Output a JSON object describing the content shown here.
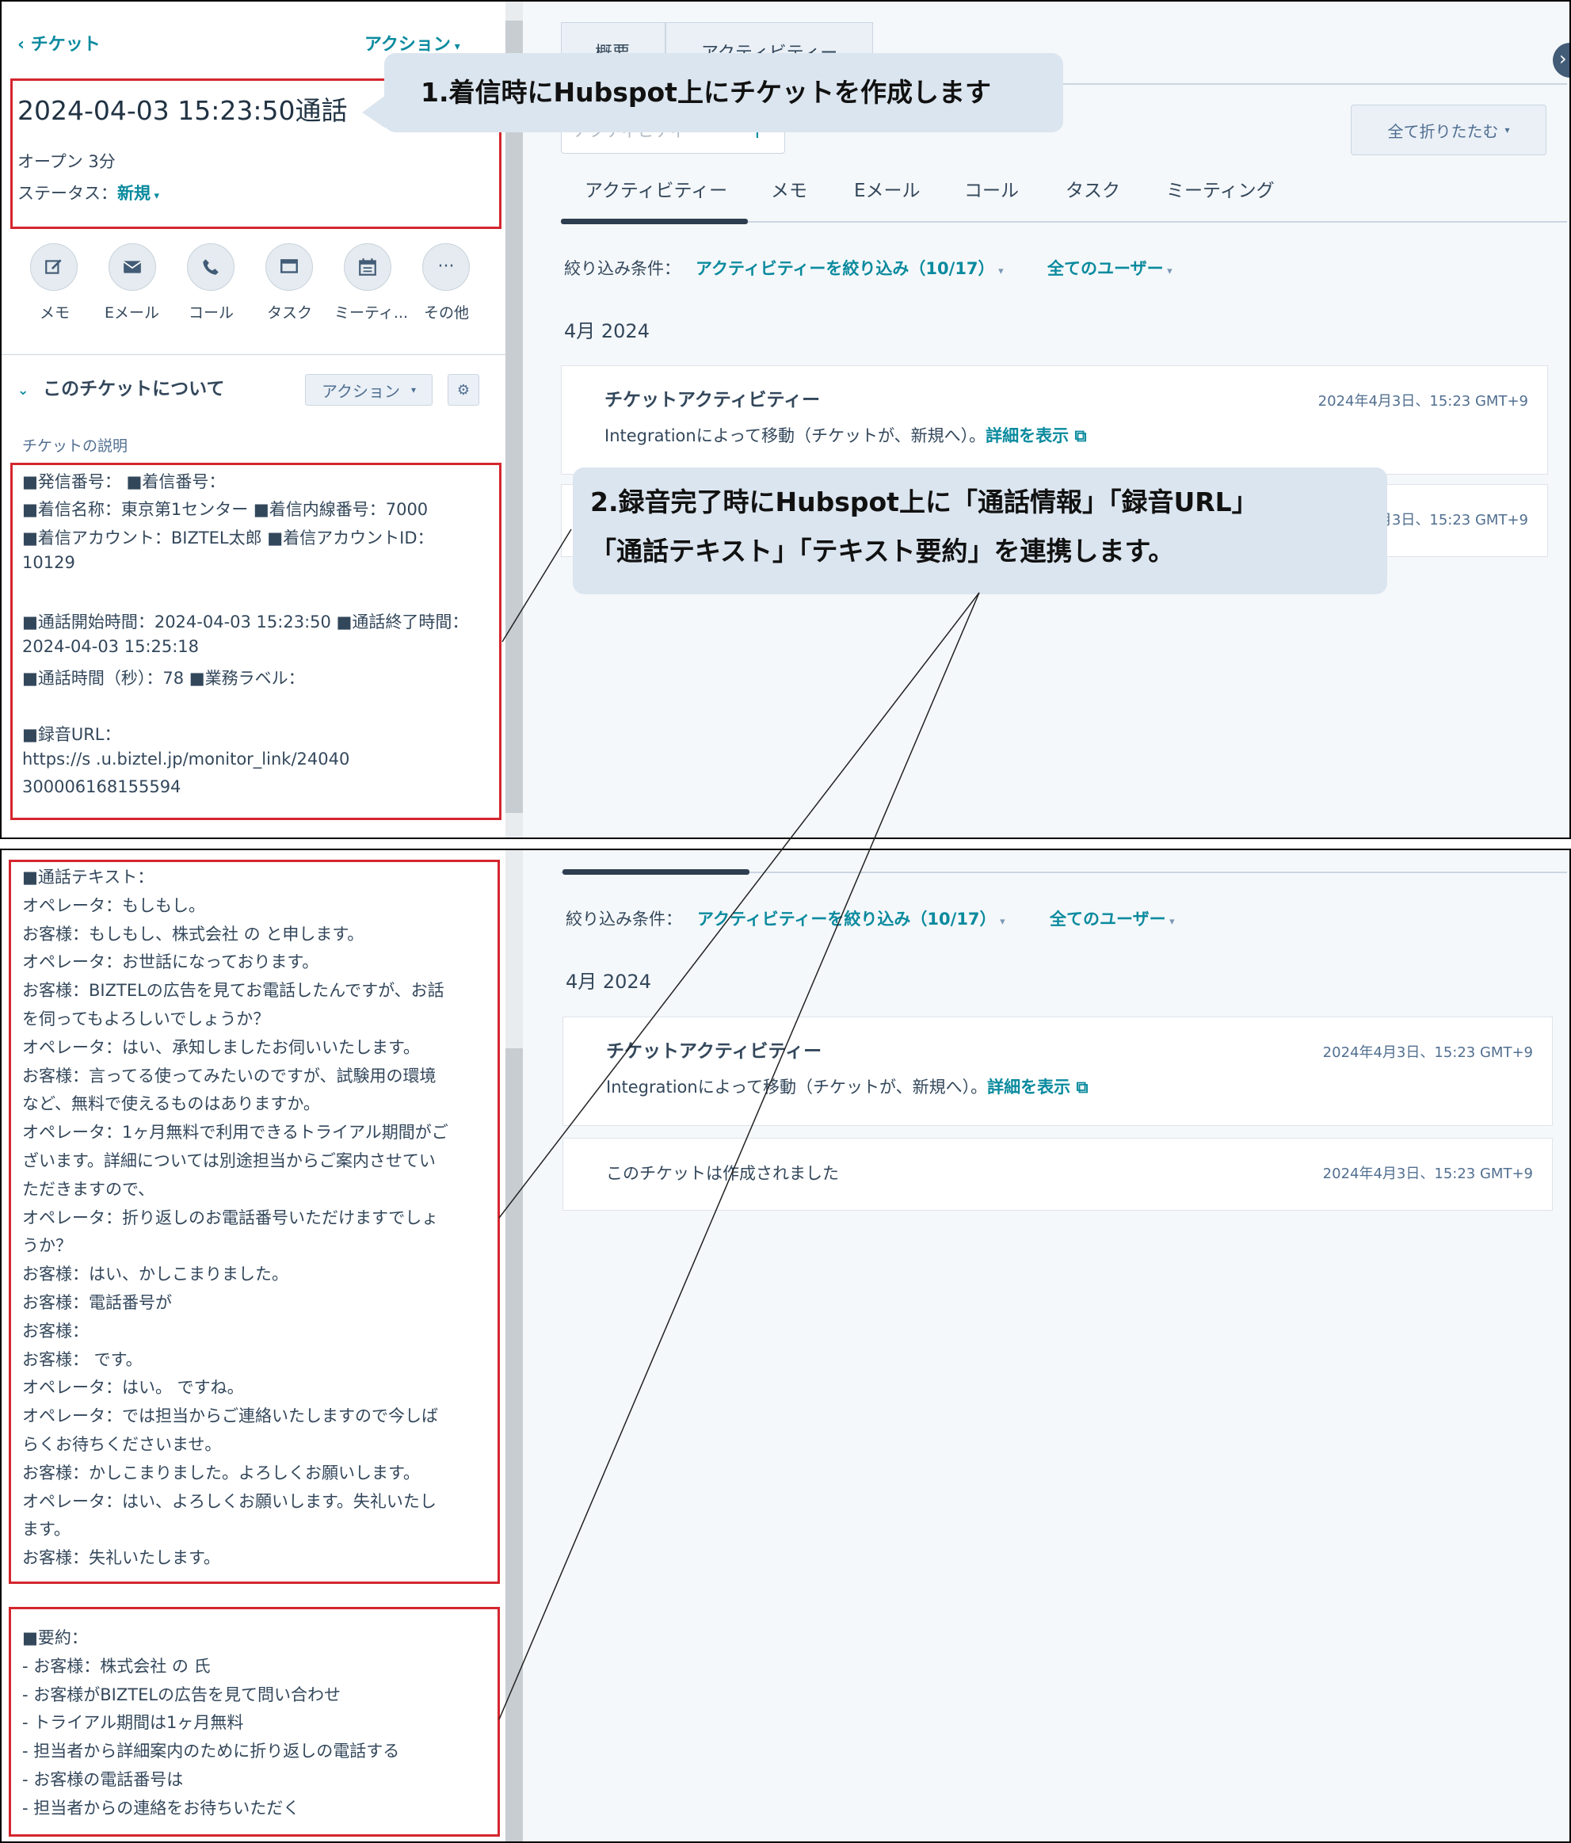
{
  "left": {
    "back_link": "チケット",
    "actions_link": "アクション",
    "ticket_title": "2024-04-03 15:23:50通話",
    "open_time": "オープン 3分",
    "status_label": "ステータス：",
    "status_value": "新規",
    "action_buttons": [
      {
        "label": "メモ",
        "icon": "edit-icon"
      },
      {
        "label": "Eメール",
        "icon": "envelope-icon"
      },
      {
        "label": "コール",
        "icon": "phone-icon"
      },
      {
        "label": "タスク",
        "icon": "monitor-icon"
      },
      {
        "label": "ミーティ...",
        "icon": "calendar-icon"
      },
      {
        "label": "その他",
        "icon": "more-icon"
      }
    ],
    "about_title": "このチケットについて",
    "about_action": "アクション",
    "description_label": "チケットの説明",
    "description_lines": [
      "■発信番号：            ■着信番号：",
      "■着信名称：東京第1センター  ■着信内線番号：7000",
      "■着信アカウント：BIZTEL太郎 ■着信アカウントID：",
      "10129",
      "",
      "■通話開始時間：2024-04-03 15:23:50 ■通話終了時間：",
      "2024-04-03 15:25:18",
      "■通話時間（秒）：78 ■業務ラベル：",
      "",
      "■録音URL：",
      "https://s               .u.biztel.jp/monitor_link/24040",
      "300006168155594"
    ],
    "transcript_lines": [
      "■通話テキスト：",
      "オペレータ：もしもし。",
      "お客様：もしもし、株式会社        の       と申します。",
      "オペレータ：お世話になっております。",
      "お客様：BIZTELの広告を見てお電話したんですが、お話",
      "を伺ってもよろしいでしょうか？",
      "オペレータ：はい、承知しましたお伺いいたします。",
      "お客様：言ってる使ってみたいのですが、試験用の環境",
      "など、無料で使えるものはありますか。",
      "オペレータ：1ヶ月無料で利用できるトライアル期間がご",
      "ざいます。詳細については別途担当からご案内させてい",
      "ただきますので、",
      "オペレータ：折り返しのお電話番号いただけますでしょ",
      "うか？",
      "お客様：はい、かしこまりました。",
      "お客様：電話番号が",
      "お客様：",
      "お客様：        です。",
      "オペレータ：はい。               ですね。",
      "オペレータ：では担当からご連絡いたしますので今しば",
      "らくお待ちくださいませ。",
      "お客様：かしこまりました。よろしくお願いします。",
      "オペレータ：はい、よろしくお願いします。失礼いたし",
      "ます。",
      "お客様：失礼いたします。"
    ],
    "summary_lines": [
      "■要約：",
      "- お客様：株式会社        の       氏",
      "- お客様がBIZTELの広告を見て問い合わせ",
      "- トライアル期間は1ヶ月無料",
      "- 担当者から詳細案内のために折り返しの電話する",
      "- お客様の電話番号は",
      "- 担当者からの連絡をお待ちいただく"
    ]
  },
  "right": {
    "tabs_top": [
      "概要",
      "アクティビティー"
    ],
    "search_placeholder": "アクティビティー",
    "collapse_all": "全て折りたたむ",
    "activity_tabs": [
      "アクティビティー",
      "メモ",
      "Eメール",
      "コール",
      "タスク",
      "ミーティング"
    ],
    "filter_label": "絞り込み条件：",
    "filter_activity": "アクティビティーを絞り込み（10/17）",
    "filter_users": "全てのユーザー",
    "month_header": "4月 2024",
    "card1_title": "チケットアクティビティー",
    "card1_time": "2024年4月3日、15:23 GMT+9",
    "card1_body": "Integrationによって移動（チケットが、新規へ）。",
    "card1_link": "詳細を表示",
    "card2_time": "2024年4月3日、15:23 GMT+9",
    "card2_text": "このチケットは作成されました"
  },
  "callouts": {
    "callout1": "1.着信時にHubspot上にチケットを作成します",
    "callout2_line1": "2.録音完了時にHubspot上に「通話情報」「録音URL」",
    "callout2_line2": "「通話テキスト」「テキスト要約」を連携します。"
  },
  "colors": {
    "accent": "#0a8a9e",
    "highlight": "#d4262e",
    "callout_bg": "#dbe5ef",
    "tab_indicator": "#2d3e50"
  }
}
